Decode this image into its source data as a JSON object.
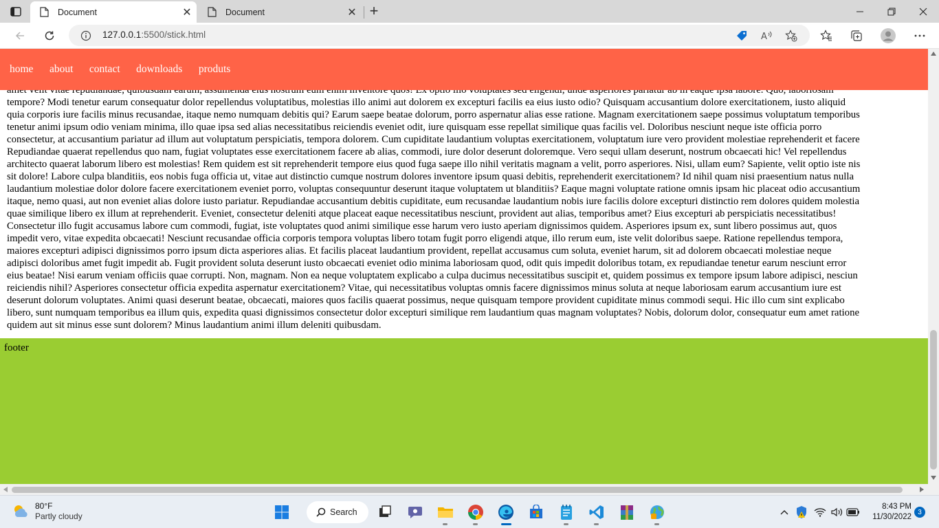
{
  "browser": {
    "tabs": [
      {
        "title": "Document",
        "active": true
      },
      {
        "title": "Document",
        "active": false
      }
    ],
    "new_tab_label": "+",
    "address": {
      "host": "127.0.0.1",
      "path": ":5500/stick.html"
    },
    "window_controls": {
      "minimize": "—",
      "restore": "❐",
      "close": "✕"
    }
  },
  "page": {
    "nav": {
      "items": [
        "home",
        "about",
        "contact",
        "downloads",
        "produts"
      ],
      "background": "#ff6347"
    },
    "body_lines": [
      "amet velit vitae repudiandae, quibusdam earum, assumenda eius nostrum eum enim inventore quos! Ex optio illo voluptates sed eligendi, unde asperiores pariatur ab in eaque ipsa labore. Quo, laboriosam",
      "tempore? Modi tenetur earum consequatur dolor repellendus voluptatibus, molestias illo animi aut dolorem ex excepturi facilis ea eius iusto odio? Quisquam accusantium dolore exercitationem, iusto aliquid",
      "quia corporis iure facilis minus recusandae, itaque nemo numquam debitis qui? Earum saepe beatae dolorum, porro aspernatur alias esse ratione. Magnam exercitationem saepe possimus voluptatum temporibus",
      "tenetur animi ipsum odio veniam minima, illo quae ipsa sed alias necessitatibus reiciendis eveniet odit, iure quisquam esse repellat similique quas facilis vel. Doloribus nesciunt neque iste officia porro",
      "consectetur, at accusantium pariatur ad illum aut voluptatum perspiciatis, tempora dolorem. Cum cupiditate laudantium voluptas exercitationem, voluptatum iure vero provident molestiae reprehenderit et facere",
      "Repudiandae quaerat repellendus quo nam, fugiat voluptates esse exercitationem facere ab alias, commodi, iure dolor deserunt doloremque. Vero sequi ullam deserunt, nostrum obcaecati hic! Vel repellendus",
      "architecto quaerat laborum libero est molestias! Rem quidem est sit reprehenderit tempore eius quod fuga saepe illo nihil veritatis magnam a velit, porro asperiores. Nisi, ullam eum? Sapiente, velit optio iste nis",
      "sit dolore! Labore culpa blanditiis, eos nobis fuga officia ut, vitae aut distinctio cumque nostrum dolores inventore ipsum quasi debitis, reprehenderit exercitationem? Id nihil quam nisi praesentium natus nulla",
      "laudantium molestiae dolor dolore facere exercitationem eveniet porro, voluptas consequuntur deserunt itaque voluptatem ut blanditiis? Eaque magni voluptate ratione omnis ipsam hic placeat odio accusantium",
      "itaque, nemo quasi, aut non eveniet alias dolore iusto pariatur. Repudiandae accusantium debitis cupiditate, eum recusandae laudantium nobis iure facilis dolore excepturi distinctio rem dolores quidem molestia",
      "quae similique libero ex illum at reprehenderit. Eveniet, consectetur deleniti atque placeat eaque necessitatibus nesciunt, provident aut alias, temporibus amet? Eius excepturi ab perspiciatis necessitatibus!",
      "Consectetur illo fugit accusamus labore cum commodi, fugiat, iste voluptates quod animi similique esse harum vero iusto aperiam dignissimos quidem. Asperiores ipsum ex, sunt libero possimus aut, quos",
      "impedit vero, vitae expedita obcaecati! Nesciunt recusandae officia corporis tempora voluptas libero totam fugit porro eligendi atque, illo rerum eum, iste velit doloribus saepe. Ratione repellendus tempora,",
      "maiores excepturi adipisci dignissimos porro ipsum dicta asperiores alias. Et facilis placeat laudantium provident, repellat accusamus cum soluta, eveniet harum, sit ad dolorem obcaecati molestiae neque",
      "adipisci doloribus amet fugit impedit ab. Fugit provident soluta deserunt iusto obcaecati eveniet odio minima laboriosam quod, odit quis impedit doloribus totam, ex repudiandae tenetur earum nesciunt error",
      "eius beatae! Nisi earum veniam officiis quae corrupti. Non, magnam. Non ea neque voluptatem explicabo a culpa ducimus necessitatibus suscipit et, quidem possimus ex tempore ipsum labore adipisci, nesciun",
      "reiciendis nihil? Asperiores consectetur officia expedita aspernatur exercitationem? Vitae, qui necessitatibus voluptas omnis facere dignissimos minus soluta at neque laboriosam earum accusantium iure est",
      "deserunt dolorum voluptates. Animi quasi deserunt beatae, obcaecati, maiores quos facilis quaerat possimus, neque quisquam tempore provident cupiditate minus commodi sequi. Hic illo cum sint explicabo",
      "libero, sunt numquam temporibus ea illum quis, expedita quasi dignissimos consectetur dolor excepturi similique rem laudantium quas magnam voluptates? Nobis, dolorum dolor, consequatur eum amet ratione",
      "quidem aut sit minus esse sunt dolorem? Minus laudantium animi illum deleniti quibusdam."
    ],
    "footer": {
      "text": "footer",
      "background": "#9acd32"
    }
  },
  "taskbar": {
    "weather": {
      "temp": "80°F",
      "condition": "Partly cloudy"
    },
    "search_label": "Search",
    "apps": [
      "start-icon",
      "search",
      "task-view-icon",
      "teams-chat-icon",
      "file-explorer-icon",
      "chrome-icon",
      "edge-icon",
      "store-icon",
      "notepad-icon",
      "vscode-icon",
      "winrar-icon",
      "globe-app-icon"
    ],
    "clock": {
      "time": "8:43 PM",
      "date": "11/30/2022"
    },
    "notification_count": "3"
  }
}
